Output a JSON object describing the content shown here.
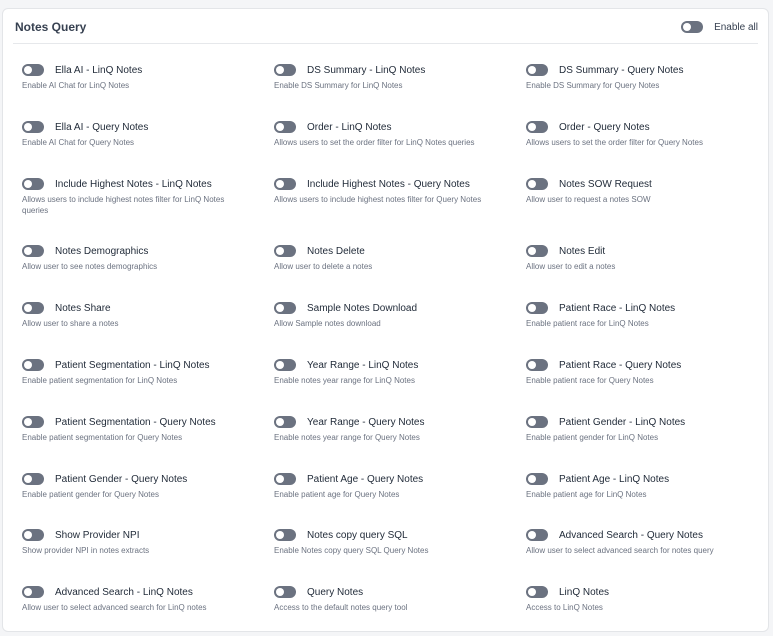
{
  "header": {
    "title": "Notes Query",
    "enable_all_label": "Enable all",
    "enable_all_on": false
  },
  "settings": [
    {
      "name": "Ella AI - LinQ Notes",
      "desc": "Enable AI Chat for LinQ Notes",
      "on": false
    },
    {
      "name": "DS Summary - LinQ Notes",
      "desc": "Enable DS Summary for LinQ Notes",
      "on": false
    },
    {
      "name": "DS Summary - Query Notes",
      "desc": "Enable DS Summary for Query Notes",
      "on": false
    },
    {
      "name": "Ella AI - Query Notes",
      "desc": "Enable AI Chat for Query Notes",
      "on": false
    },
    {
      "name": "Order - LinQ Notes",
      "desc": "Allows users to set the order filter for LinQ Notes queries",
      "on": false
    },
    {
      "name": "Order - Query Notes",
      "desc": "Allows users to set the order filter for Query Notes",
      "on": false
    },
    {
      "name": "Include Highest Notes - LinQ Notes",
      "desc": "Allows users to include highest notes filter for LinQ Notes queries",
      "on": false
    },
    {
      "name": "Include Highest Notes - Query Notes",
      "desc": "Allows users to include highest notes filter for Query Notes",
      "on": false
    },
    {
      "name": "Notes SOW Request",
      "desc": "Allow user to request a notes SOW",
      "on": false
    },
    {
      "name": "Notes Demographics",
      "desc": "Allow user to see notes demographics",
      "on": false
    },
    {
      "name": "Notes Delete",
      "desc": "Allow user to delete a notes",
      "on": false
    },
    {
      "name": "Notes Edit",
      "desc": "Allow user to edit a notes",
      "on": false
    },
    {
      "name": "Notes Share",
      "desc": "Allow user to share a notes",
      "on": false
    },
    {
      "name": "Sample Notes Download",
      "desc": "Allow Sample notes download",
      "on": false
    },
    {
      "name": "Patient Race - LinQ Notes",
      "desc": "Enable patient race for LinQ Notes",
      "on": false
    },
    {
      "name": "Patient Segmentation - LinQ Notes",
      "desc": "Enable patient segmentation for LinQ Notes",
      "on": false
    },
    {
      "name": "Year Range - LinQ Notes",
      "desc": "Enable notes year range for LinQ Notes",
      "on": false
    },
    {
      "name": "Patient Race - Query Notes",
      "desc": "Enable patient race for Query Notes",
      "on": false
    },
    {
      "name": "Patient Segmentation - Query Notes",
      "desc": "Enable patient segmentation for Query Notes",
      "on": false
    },
    {
      "name": "Year Range - Query Notes",
      "desc": "Enable notes year range for Query Notes",
      "on": false
    },
    {
      "name": "Patient Gender - LinQ Notes",
      "desc": "Enable patient gender for LinQ Notes",
      "on": false
    },
    {
      "name": "Patient Gender - Query Notes",
      "desc": "Enable patient gender for Query Notes",
      "on": false
    },
    {
      "name": "Patient Age - Query Notes",
      "desc": "Enable patient age for Query Notes",
      "on": false
    },
    {
      "name": "Patient Age - LinQ Notes",
      "desc": "Enable patient age for LinQ Notes",
      "on": false
    },
    {
      "name": "Show Provider NPI",
      "desc": "Show provider NPI in notes extracts",
      "on": false
    },
    {
      "name": "Notes copy query SQL",
      "desc": "Enable Notes copy query SQL Query Notes",
      "on": false
    },
    {
      "name": "Advanced Search - Query Notes",
      "desc": "Allow user to select advanced search for notes query",
      "on": false
    },
    {
      "name": "Advanced Search - LinQ Notes",
      "desc": "Allow user to select advanced search for LinQ notes",
      "on": false
    },
    {
      "name": "Query Notes",
      "desc": "Access to the default notes query tool",
      "on": false
    },
    {
      "name": "LinQ Notes",
      "desc": "Access to LinQ Notes",
      "on": false
    }
  ]
}
